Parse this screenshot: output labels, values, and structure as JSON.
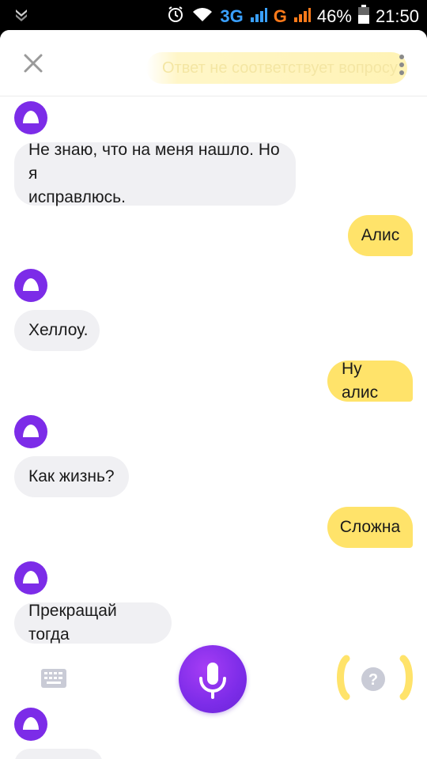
{
  "statusbar": {
    "net_3g": "3G",
    "net_g": "G",
    "battery": "46%",
    "time": "21:50"
  },
  "topbar": {
    "feedback_text": "Ответ не соответствует вопросу"
  },
  "messages": [
    {
      "role": "assistant",
      "lines": [
        "Не знаю, что на меня нашло. Но я",
        "исправлюсь."
      ]
    },
    {
      "role": "user",
      "text": "Алис"
    },
    {
      "role": "assistant",
      "text": "Хеллоу."
    },
    {
      "role": "user",
      "text": "Ну алис"
    },
    {
      "role": "assistant",
      "text": "Как жизнь?"
    },
    {
      "role": "user",
      "text": "Сложна"
    },
    {
      "role": "assistant",
      "text": "Прекращай тогда"
    }
  ],
  "colors": {
    "accent": "#7c2ce8",
    "user_bubble": "#ffe36a",
    "assistant_bubble": "#f0f0f3"
  },
  "icons": [
    "alice-avatar-icon",
    "close-icon",
    "more-vertical-icon",
    "keyboard-icon",
    "microphone-icon",
    "question-icon"
  ]
}
